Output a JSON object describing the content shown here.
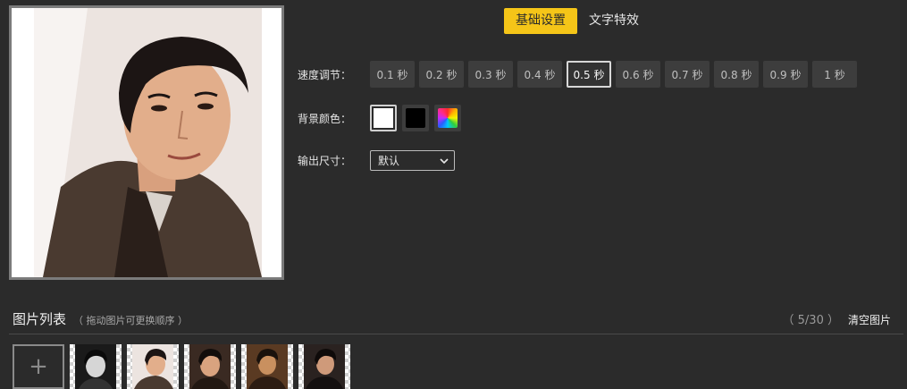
{
  "tabs": [
    {
      "label": "基础设置",
      "active": true
    },
    {
      "label": "文字特效",
      "active": false
    }
  ],
  "settings": {
    "speed": {
      "label": "速度调节：",
      "options": [
        "0.1 秒",
        "0.2 秒",
        "0.3 秒",
        "0.4 秒",
        "0.5 秒",
        "0.6 秒",
        "0.7 秒",
        "0.8 秒",
        "0.9 秒",
        "1 秒"
      ],
      "selected": "0.5 秒"
    },
    "background": {
      "label": "背景颜色：",
      "options": [
        "white",
        "black",
        "custom-rainbow"
      ],
      "selected": "white"
    },
    "size": {
      "label": "输出尺寸：",
      "value": "默认"
    }
  },
  "image_list": {
    "title": "图片列表",
    "hint": "（ 拖动图片可更换顺序 ）",
    "count": "（ 5/30 ）",
    "clear_label": "清空图片",
    "add_label": "+",
    "thumbnails": [
      {
        "name": "thumb-1",
        "tone": "bw"
      },
      {
        "name": "thumb-2",
        "tone": "warm"
      },
      {
        "name": "thumb-3",
        "tone": "warm"
      },
      {
        "name": "thumb-4",
        "tone": "warm"
      },
      {
        "name": "thumb-5",
        "tone": "dark"
      }
    ]
  },
  "colors": {
    "accent": "#f5c518",
    "background": "#2b2b2b",
    "button": "#3d3d3d"
  }
}
